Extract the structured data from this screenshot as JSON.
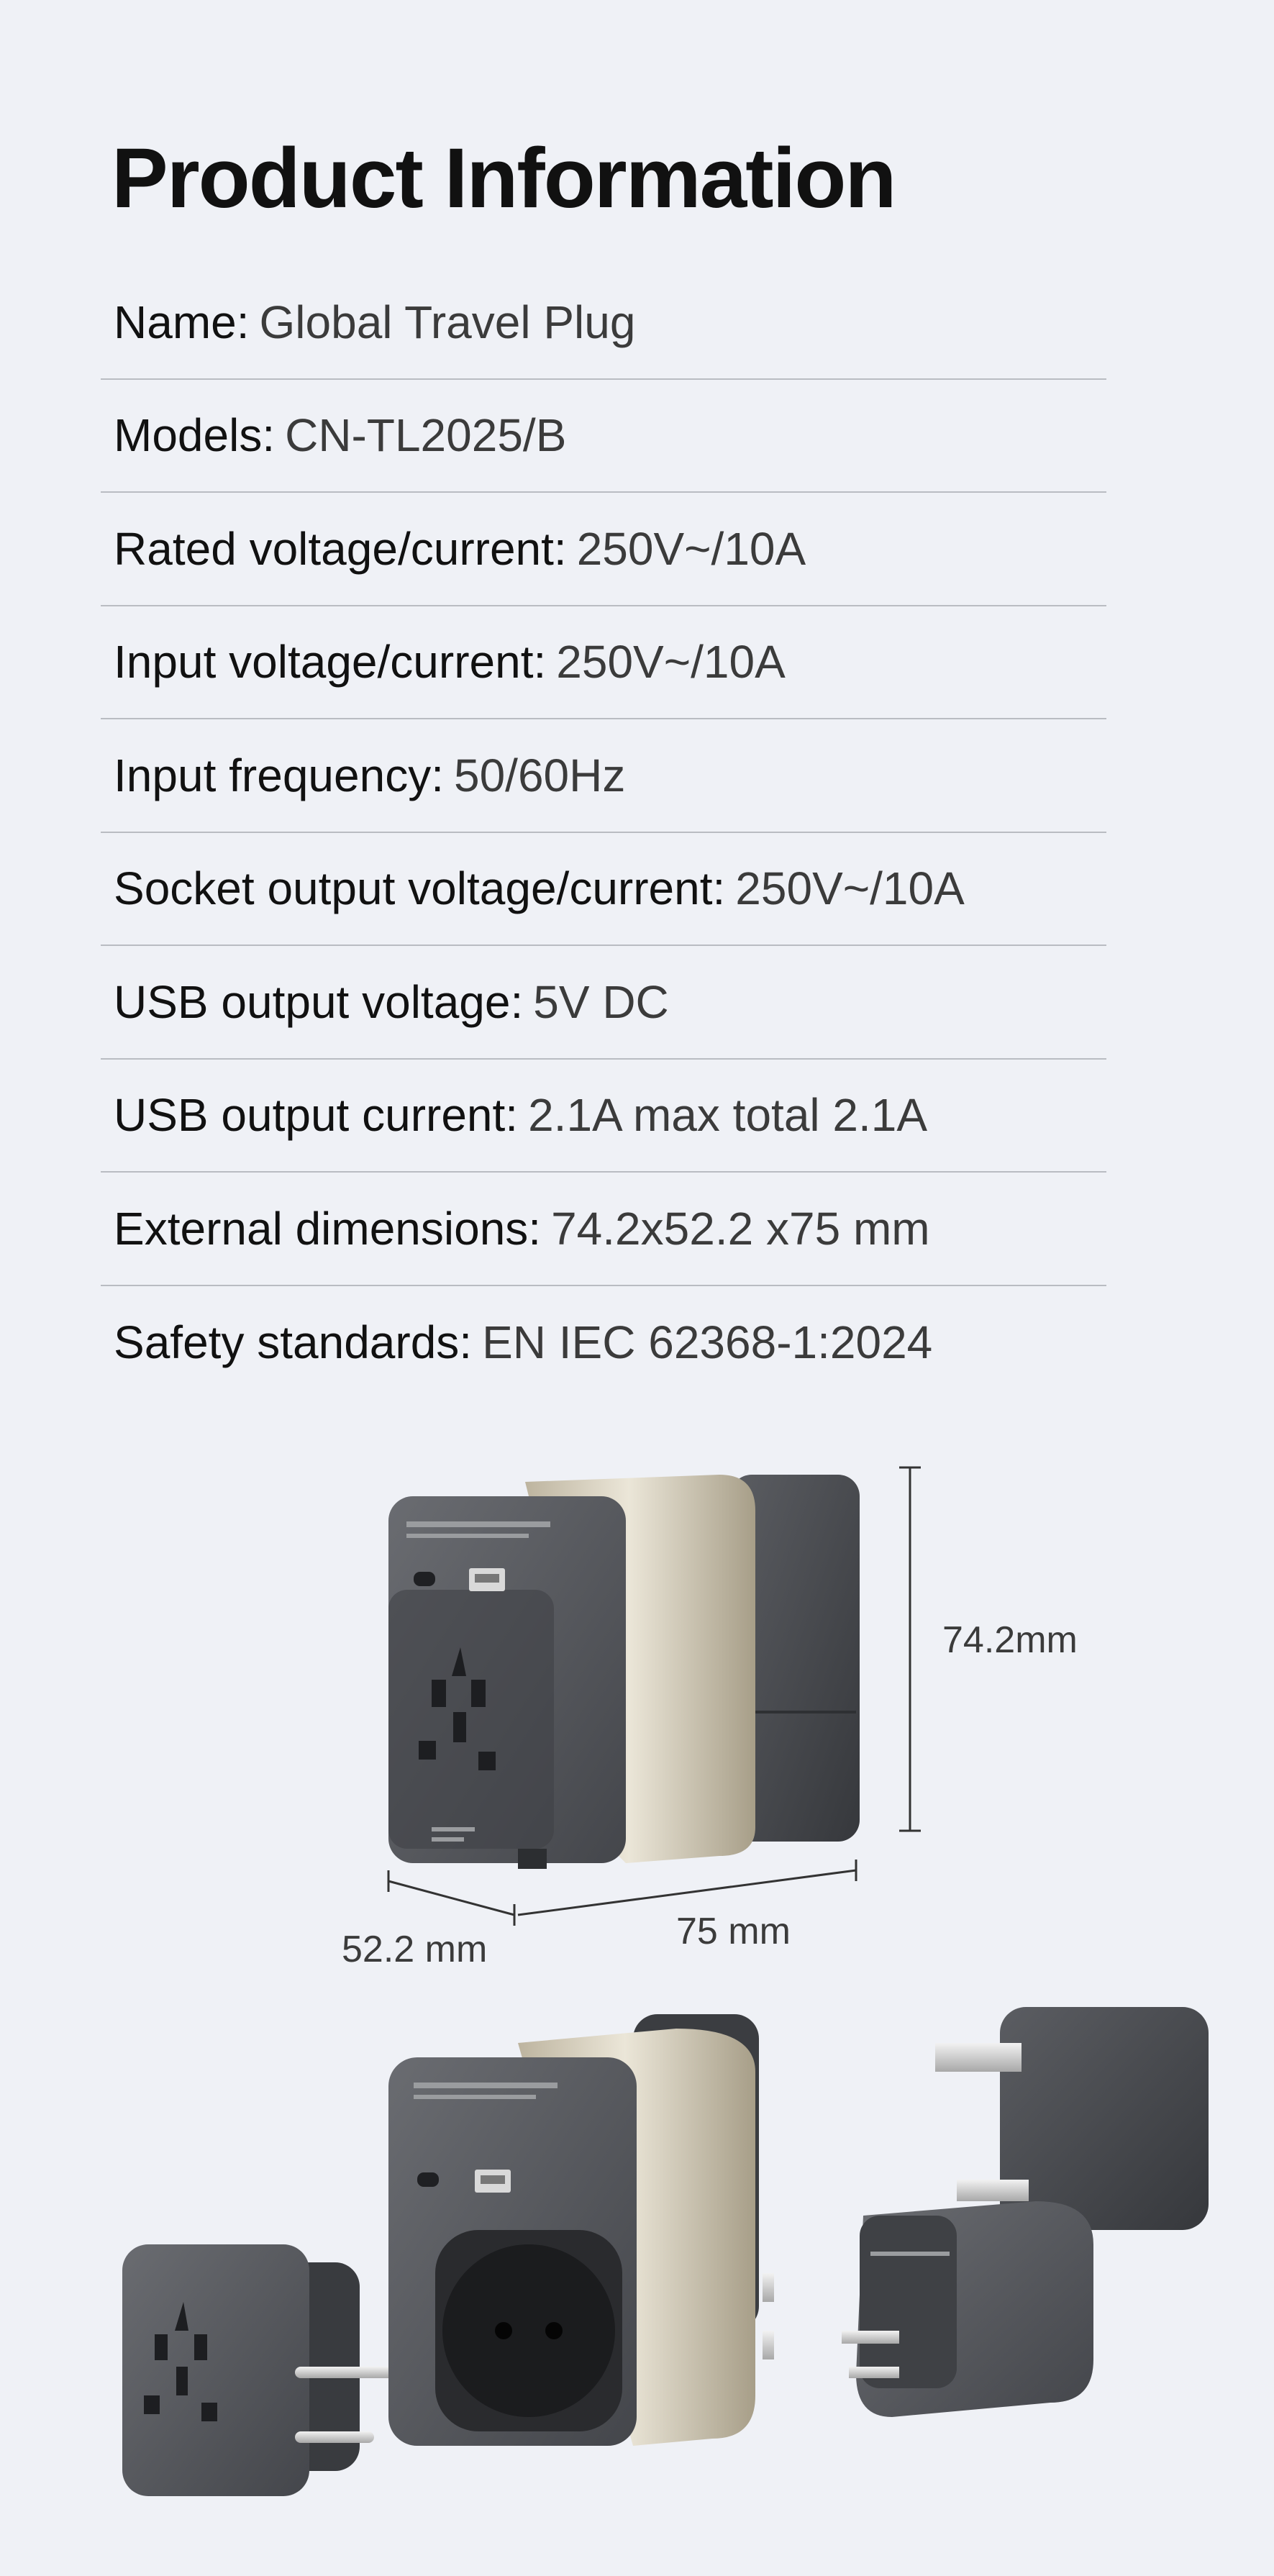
{
  "heading": "Product Information",
  "specs": [
    {
      "label": "Name:",
      "value": "Global Travel Plug"
    },
    {
      "label": "Models:",
      "value": "CN-TL2025/B"
    },
    {
      "label": "Rated voltage/current:",
      "value": "250V~/10A"
    },
    {
      "label": "Input voltage/current:",
      "value": "250V~/10A"
    },
    {
      "label": "Input frequency:",
      "value": "50/60Hz"
    },
    {
      "label": "Socket output voltage/current:",
      "value": "250V~/10A"
    },
    {
      "label": "USB output voltage:",
      "value": "5V DC"
    },
    {
      "label": "USB output current:",
      "value": "2.1A max total 2.1A"
    },
    {
      "label": "External dimensions:",
      "value": "74.2x52.2 x75 mm"
    },
    {
      "label": "Safety standards:",
      "value": "EN IEC 62368-1:2024"
    }
  ],
  "dimensions": {
    "height": "74.2mm",
    "depth": "52.2 mm",
    "length": "75 mm"
  },
  "colors": {
    "background": "#eff1f6",
    "body_dark": "#4a4c51",
    "band_gold": "#d9d2bf",
    "divider": "#b9bcc2"
  }
}
